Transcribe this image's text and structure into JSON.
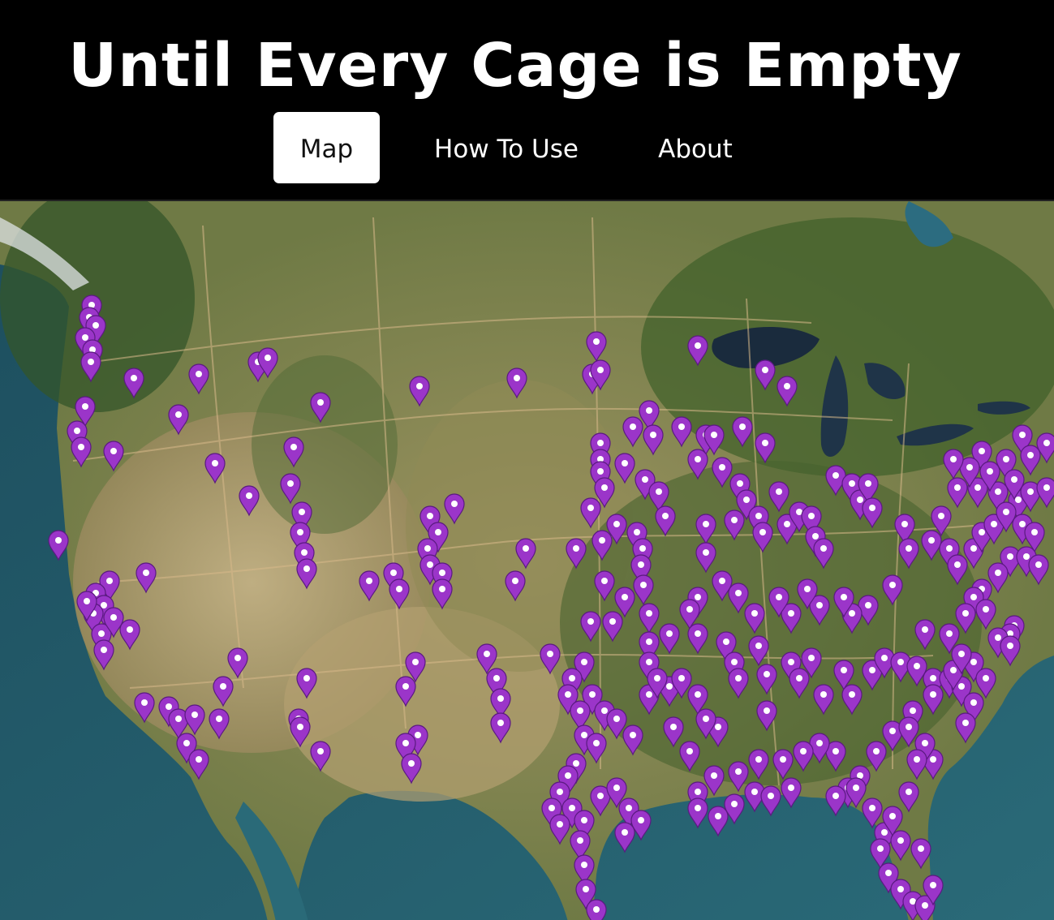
{
  "title": "Until Every Cage is Empty",
  "nav": {
    "items": [
      {
        "label": "Map",
        "active": true
      },
      {
        "label": "How To Use",
        "active": false
      },
      {
        "label": "About",
        "active": false
      }
    ]
  },
  "map": {
    "basemap": "satellite imagery of the contiguous United States",
    "marker_color": "#9b35c9",
    "marker_icon": "map-pin-icon"
  }
}
